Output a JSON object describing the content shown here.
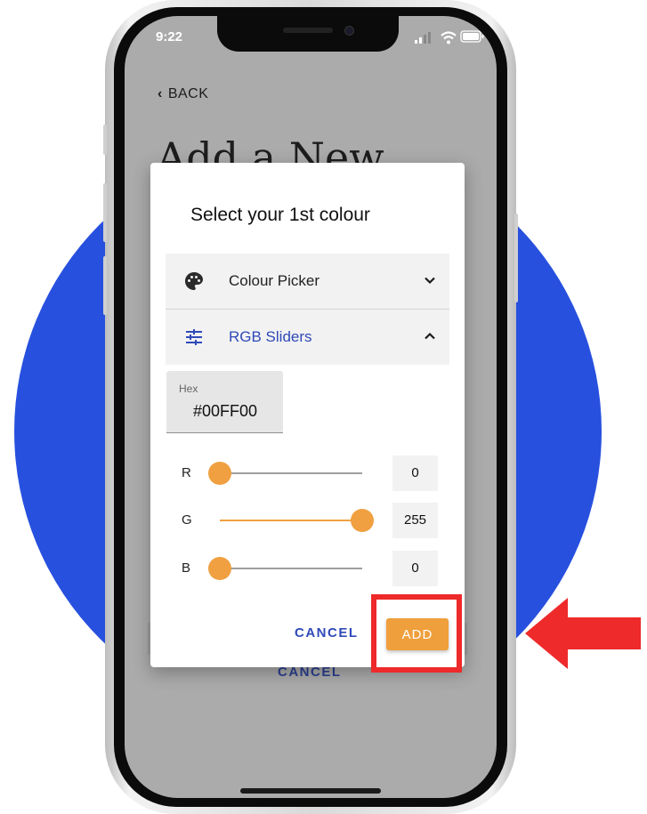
{
  "status_bar": {
    "time": "9:22"
  },
  "back_link": {
    "label": "BACK"
  },
  "page_title": "Add a New",
  "background_cancel_label": "CANCEL",
  "dialog": {
    "title": "Select your 1st colour",
    "accordion": [
      {
        "label": "Colour Picker",
        "icon": "palette-icon",
        "expanded": false
      },
      {
        "label": "RGB Sliders",
        "icon": "tune-icon",
        "expanded": true
      }
    ],
    "hex": {
      "label": "Hex",
      "value": "#00FF00"
    },
    "sliders": [
      {
        "channel": "R",
        "value": "0",
        "fraction": 0.0
      },
      {
        "channel": "G",
        "value": "255",
        "fraction": 1.0
      },
      {
        "channel": "B",
        "value": "0",
        "fraction": 0.0
      }
    ],
    "cancel_label": "CANCEL",
    "add_label": "ADD"
  },
  "colors": {
    "accent_orange": "#ef9f3c",
    "link_blue": "#2f4ab8",
    "background_circle": "#2750de",
    "highlight_red": "#ee2a2a"
  }
}
